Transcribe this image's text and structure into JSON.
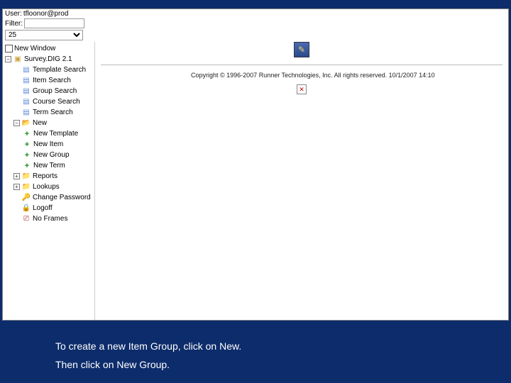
{
  "header": {
    "user_label": "User:",
    "user_value": "tfloonor@prod",
    "filter_label": "Filter:",
    "filter_value": "",
    "limit_value": "25"
  },
  "tree": {
    "new_window": "New Window",
    "root": "Survey.DIG 2.1",
    "template_search": "Template Search",
    "item_search": "Item Search",
    "group_search": "Group Search",
    "course_search": "Course Search",
    "term_search": "Term Search",
    "new": "New",
    "new_template": "New Template",
    "new_item": "New Item",
    "new_group": "New Group",
    "new_term": "New Term",
    "reports": "Reports",
    "lookups": "Lookups",
    "change_password": "Change Password",
    "logoff": "Logoff",
    "no_frames": "No Frames"
  },
  "content": {
    "copyright": "Copyright © 1996-2007 Runner Technologies, Inc. All rights reserved. 10/1/2007 14:10"
  },
  "caption": {
    "line1": "To create a new Item Group, click on New.",
    "line2": "Then click on New Group."
  }
}
